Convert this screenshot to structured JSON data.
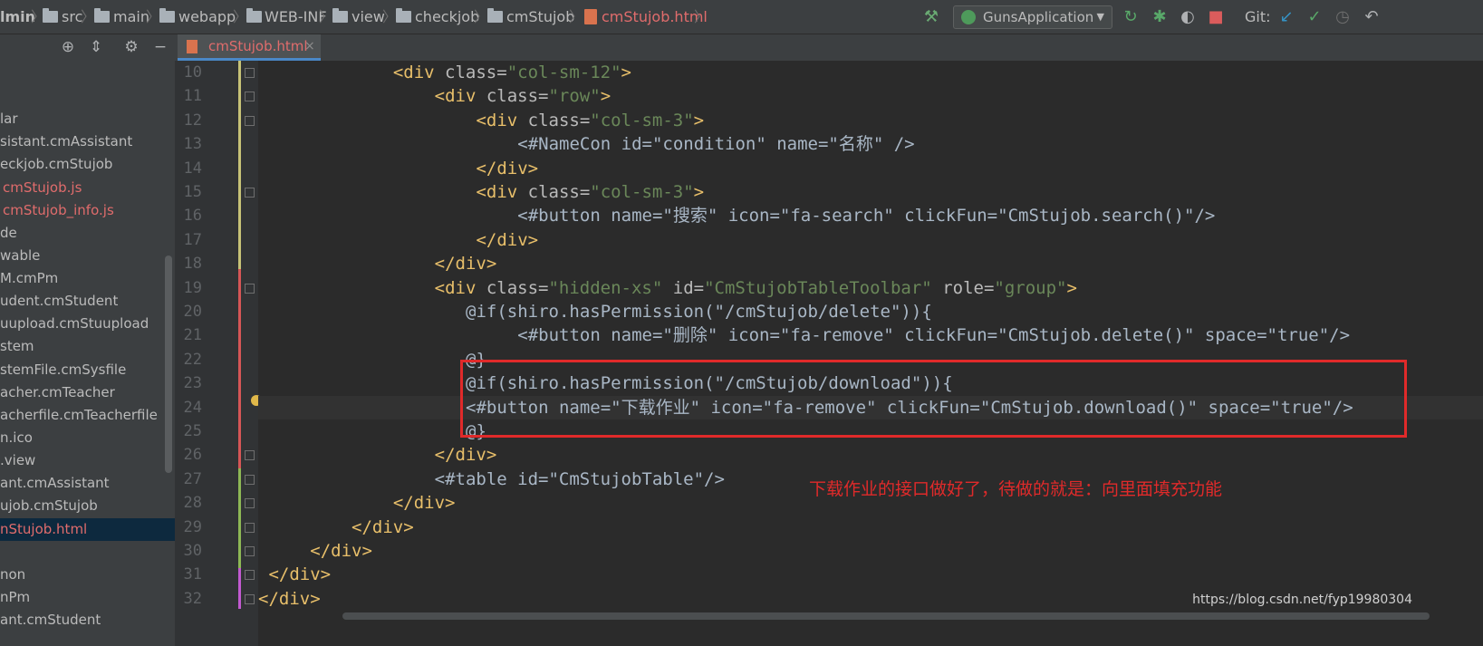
{
  "breadcrumb": {
    "items": [
      {
        "label": "lmin"
      },
      {
        "label": "src"
      },
      {
        "label": "main"
      },
      {
        "label": "webapp"
      },
      {
        "label": "WEB-INF"
      },
      {
        "label": "view"
      },
      {
        "label": "checkjob"
      },
      {
        "label": "cmStujob"
      },
      {
        "label": "cmStujob.html"
      }
    ],
    "separator": "〉"
  },
  "toolbar": {
    "run_config": "GunsApplication",
    "git_label": "Git:",
    "icons": [
      "hammer-icon",
      "rerun-icon",
      "debug-icon",
      "coverage-icon",
      "stop-icon",
      "update-icon",
      "commit-icon",
      "history-icon",
      "revert-icon"
    ]
  },
  "project_panel": {
    "items": [
      {
        "label": "lar"
      },
      {
        "label": "sistant.cmAssistant"
      },
      {
        "label": "eckjob.cmStujob"
      },
      {
        "label": "cmStujob.js"
      },
      {
        "label": "cmStujob_info.js"
      },
      {
        "label": "de"
      },
      {
        "label": "wable"
      },
      {
        "label": "M.cmPm"
      },
      {
        "label": "udent.cmStudent"
      },
      {
        "label": "uupload.cmStuupload"
      },
      {
        "label": "stem"
      },
      {
        "label": "stemFile.cmSysfile"
      },
      {
        "label": "acher.cmTeacher"
      },
      {
        "label": "acherfile.cmTeacherfile"
      },
      {
        "label": "n.ico"
      },
      {
        "label": ".view"
      },
      {
        "label": "ant.cmAssistant"
      },
      {
        "label": "ujob.cmStujob"
      },
      {
        "label": "nStujob.html"
      },
      {
        "label": ""
      },
      {
        "label": "non"
      },
      {
        "label": "nPm"
      },
      {
        "label": "ant.cmStudent"
      }
    ]
  },
  "editor": {
    "tab_label": "cmStujob.html",
    "tab_close": "×",
    "line_numbers": [
      "10",
      "11",
      "12",
      "13",
      "14",
      "15",
      "16",
      "17",
      "18",
      "19",
      "20",
      "21",
      "22",
      "23",
      "24",
      "25",
      "26",
      "27",
      "28",
      "29",
      "30",
      "31",
      "32"
    ],
    "lines": [
      [
        "<div",
        " class=",
        "\"col-sm-12\"",
        ">"
      ],
      [
        "<div",
        " class=",
        "\"row\"",
        ">"
      ],
      [
        "<div",
        " class=",
        "\"col-sm-3\"",
        ">"
      ],
      [
        "<#NameCon id=\"condition\" name=\"名称\" />"
      ],
      [
        "</div>"
      ],
      [
        "<div",
        " class=",
        "\"col-sm-3\"",
        ">"
      ],
      [
        "<#button name=\"搜索\" icon=\"fa-search\" clickFun=\"CmStujob.search()\"/>"
      ],
      [
        "</div>"
      ],
      [
        "</div>"
      ],
      [
        "<div",
        " class=",
        "\"hidden-xs\"",
        " id=",
        "\"CmStujobTableToolbar\"",
        " role=",
        "\"group\"",
        ">"
      ],
      [
        "@if(shiro.hasPermission(\"/cmStujob/delete\")){"
      ],
      [
        "<#button name=\"删除\" icon=\"fa-remove\" clickFun=\"CmStujob.delete()\" space=\"true\"/>"
      ],
      [
        "@}"
      ],
      [
        "@if(shiro.hasPermission(\"/cmStujob/download\")){"
      ],
      [
        "<#button name=\"下载作业\" icon=\"fa-remove\" clickFun=\"CmStujob.download()\" space=\"true\"/>"
      ],
      [
        "@}"
      ],
      [
        "</div>"
      ],
      [
        "<#table id=\"CmStujobTable\"/>"
      ],
      [
        "</div>"
      ],
      [
        "</div>"
      ],
      [
        "</div>"
      ],
      [
        "</div>"
      ],
      [
        "</div>"
      ]
    ]
  },
  "annotation": "下载作业的接口做好了，待做的就是：向里面填充功能",
  "watermark": "https://blog.csdn.net/fyp19980304",
  "colors": {
    "tag": "#e8bf6a",
    "attr": "#bababa",
    "value": "#6a8759",
    "annotation": "#e02a2a"
  }
}
